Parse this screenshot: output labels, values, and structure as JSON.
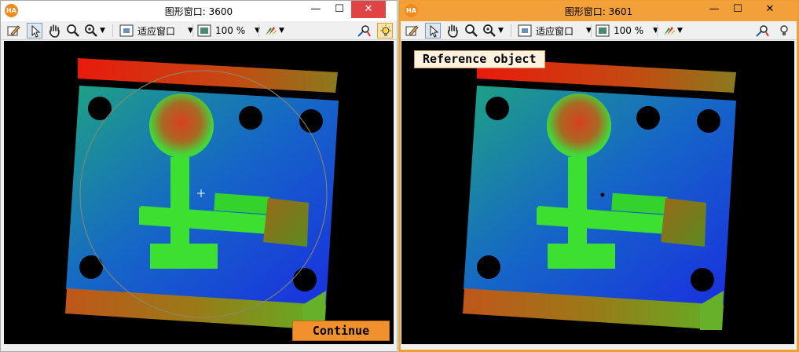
{
  "windows": [
    {
      "title": "图形窗口: 3600",
      "zoom": "100 %",
      "fit_label": "适应窗口",
      "button": "Continue"
    },
    {
      "title": "图形窗口: 3601",
      "zoom": "100 %",
      "fit_label": "适应窗口",
      "label": "Reference object"
    }
  ],
  "app_logo": "HA",
  "controls": {
    "minimize": "—",
    "maximize": "☐",
    "close": "✕"
  },
  "colors": {
    "accent_orange": "#f0912e",
    "active_frame": "#f0a030",
    "close_red": "#e04343"
  },
  "icons": [
    "edit-icon",
    "pointer-icon",
    "hand-icon",
    "zoom-icon",
    "zoom-plus-icon",
    "fit-window-icon",
    "zoom-level-icon",
    "color-palette-icon",
    "inspect-icon",
    "light-icon"
  ]
}
